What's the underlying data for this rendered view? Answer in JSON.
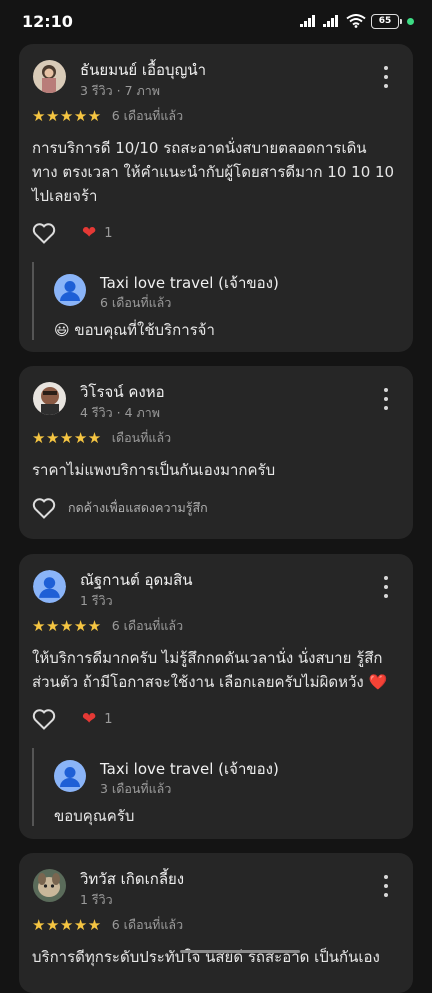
{
  "status": {
    "time": "12:10",
    "battery": "65"
  },
  "reviews": [
    {
      "name": "ธันยมนย์ เอื้อบุญนำ",
      "meta": "3 รีวิว · 7 ภาพ",
      "stars": "★★★★★",
      "date": "6 เดือนที่แล้ว",
      "text_lines": [
        "การบริการดี 10/10 รถสะอาดนั่งสบายตลอดการเดิน",
        "ทาง ตรงเวลา ให้คำแนะนำกับผู้โดยสารดีมาก 10 10 10",
        "ไปเลยจร้า"
      ],
      "reaction_count": "1",
      "reply": {
        "owner": "Taxi love travel (เจ้าของ)",
        "date": "6 เดือนที่แล้ว",
        "text": "😃 ขอบคุณที่ใช้บริการจ้า"
      }
    },
    {
      "name": "วิโรจน์ คงหอ",
      "meta": "4 รีวิว · 4 ภาพ",
      "stars": "★★★★★",
      "date": "เดือนที่แล้ว",
      "text_lines": [
        "ราคาไม่แพงบริการเป็นกันเองมากครับ"
      ],
      "hint": "กดค้างเพื่อแสดงความรู้สึก"
    },
    {
      "name": "ณัฐกานต์ อุดมสิน",
      "meta": "1 รีวิว",
      "stars": "★★★★★",
      "date": "6 เดือนที่แล้ว",
      "text_lines": [
        "ให้บริการดีมากครับ ไม่รู้สึกกดดันเวลานั่ง นั่งสบาย รู้สึก",
        "ส่วนตัว ถ้ามีโอกาสจะใช้งาน เลือกเลยครับไม่ผิดหวัง ❤️"
      ],
      "reaction_count": "1",
      "reply": {
        "owner": "Taxi love travel (เจ้าของ)",
        "date": "3 เดือนที่แล้ว",
        "text": "ขอบคุณครับ"
      }
    },
    {
      "name": "วิทวัส เกิดเกลี้ยง",
      "meta": "1 รีวิว",
      "stars": "★★★★★",
      "date": "6 เดือนที่แล้ว",
      "text_lines": [
        "บริการดีทุกระดับประทับใจ นิสัยดี รถสะอาด เป็นกันเอง"
      ]
    }
  ],
  "colors": {
    "card": "#262626",
    "star": "#f5c542",
    "heart": "#e53935",
    "owner_avatar": "#8ab4f8"
  }
}
